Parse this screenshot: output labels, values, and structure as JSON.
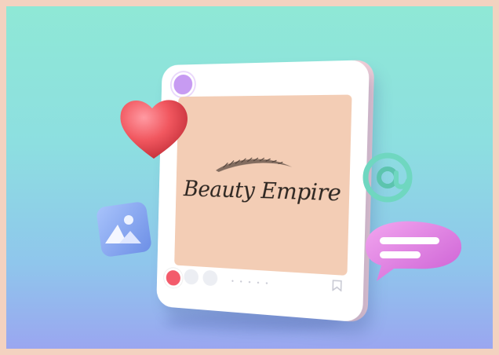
{
  "post": {
    "brand_text": "Beauty Empire",
    "photo_bg_color": "#f3cdb5",
    "avatar_color": "#c79bf2",
    "carousel_dots": "• • • • •"
  },
  "decor": {
    "icons": [
      "heart-icon",
      "at-sign-icon",
      "image-gallery-icon",
      "chat-bubble-icon"
    ],
    "heart_color": "#f1575f",
    "at_color": "#6fd7c0",
    "bubble_color": "#e07be0",
    "image_tile_color": "#8aa8ef"
  },
  "background": {
    "border_color": "#f3d2c0",
    "gradient_top": "#8fe8d6",
    "gradient_bottom": "#9aa6f0"
  }
}
